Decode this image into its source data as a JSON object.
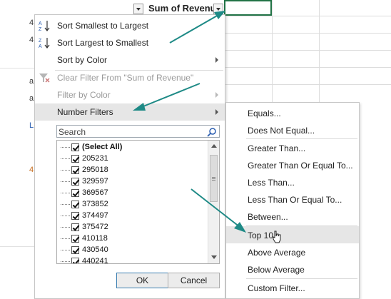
{
  "column_header": {
    "title": "Sum of Revenue",
    "dropdown_icon": "filter-dropdown-arrow-icon"
  },
  "sheet": {
    "left_fragments": [
      "4",
      "4",
      "a",
      "a",
      "L",
      "4"
    ]
  },
  "menu": {
    "sort_asc": "Sort Smallest to Largest",
    "sort_desc": "Sort Largest to Smallest",
    "sort_color": "Sort by Color",
    "clear_filter": "Clear Filter From \"Sum of Revenue\"",
    "filter_color": "Filter by Color",
    "number_filters": "Number Filters",
    "search_placeholder": "Search",
    "list_items": [
      "(Select All)",
      "205231",
      "295018",
      "329597",
      "369567",
      "373852",
      "374497",
      "375472",
      "410118",
      "430540",
      "440241"
    ],
    "ok": "OK",
    "cancel": "Cancel"
  },
  "submenu": {
    "items": [
      "Equals...",
      "Does Not Equal...",
      "Greater Than...",
      "Greater Than Or Equal To...",
      "Less Than...",
      "Less Than Or Equal To...",
      "Between...",
      "Top 10...",
      "Above Average",
      "Below Average",
      "Custom Filter..."
    ]
  },
  "colors": {
    "annotation_arrow": "#1e8a86",
    "selection_border": "#217346",
    "highlight": "#e6e6e6"
  }
}
